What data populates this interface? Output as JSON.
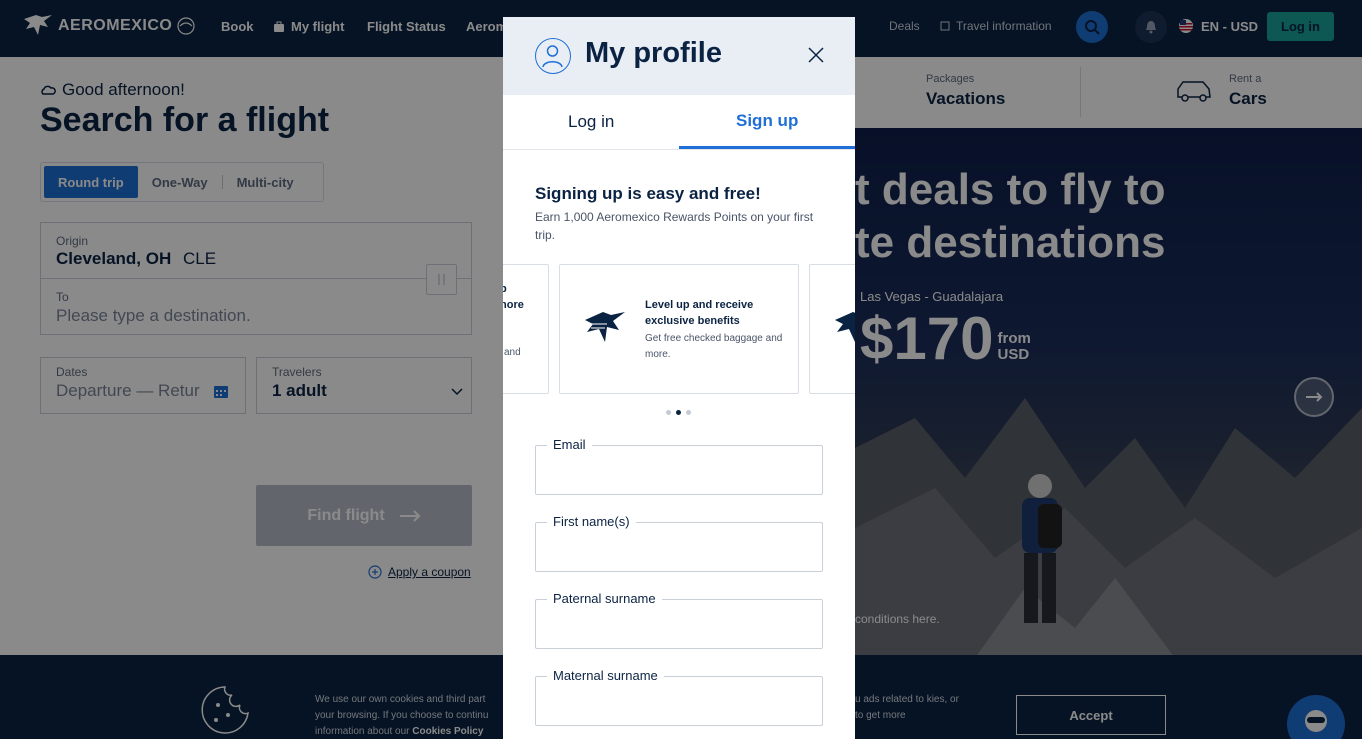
{
  "nav": {
    "brand": "AEROMEXICO",
    "links": [
      "Book",
      "My flight",
      "Flight Status",
      "Aerom"
    ],
    "right_links": [
      "Deals",
      "Travel information"
    ],
    "locale": "EN - USD",
    "login": "Log in"
  },
  "search": {
    "greeting": "Good afternoon!",
    "headline": "Search for a flight",
    "trip_types": [
      "Round trip",
      "One-Way",
      "Multi-city"
    ],
    "origin_label": "Origin",
    "origin_city": "Cleveland, OH",
    "origin_code": "CLE",
    "to_label": "To",
    "to_placeholder": "Please type a destination.",
    "dates_label": "Dates",
    "dates_placeholder": "Departure — Retur",
    "travelers_label": "Travelers",
    "travelers_value": "1 adult",
    "find_button": "Find flight",
    "coupon": "Apply a coupon"
  },
  "promo": {
    "tab1_small": "Packages",
    "tab1_big": "Vacations",
    "tab2_small": "Rent a",
    "tab2_big": "Cars",
    "hero_line1": "t deals to fly to",
    "hero_line2": "te destinations",
    "route": "Las Vegas - Guadalajara",
    "price": "$170",
    "price_from": "from",
    "price_currency": "USD",
    "terms": "conditions here."
  },
  "cookie": {
    "text_left": "We use our own cookies and third part your browsing. If you choose to continu information about our",
    "policy_link": "Cookies Policy",
    "text_right": "u ads related to kies, or to get more",
    "accept": "Accept"
  },
  "modal": {
    "title": "My profile",
    "tab_login": "Log in",
    "tab_signup": "Sign up",
    "signup_title": "Signing up is easy and free!",
    "signup_sub": "Earn 1,000 Aeromexico Rewards Points on your first trip.",
    "card_left_title": "p\nnore",
    "card_left_body": "and",
    "card_title": "Level up and receive exclusive benefits",
    "card_body": "Get free checked baggage and more.",
    "fields": [
      {
        "label": "Email",
        "value": ""
      },
      {
        "label": "First name(s)",
        "value": ""
      },
      {
        "label": "Paternal surname",
        "value": ""
      },
      {
        "label": "Maternal surname",
        "value": ""
      }
    ]
  },
  "colors": {
    "navy": "#0b2343",
    "blue": "#1f6fd6",
    "teal": "#1aa39a",
    "overlay": "rgba(0,0,0,0.46)"
  }
}
